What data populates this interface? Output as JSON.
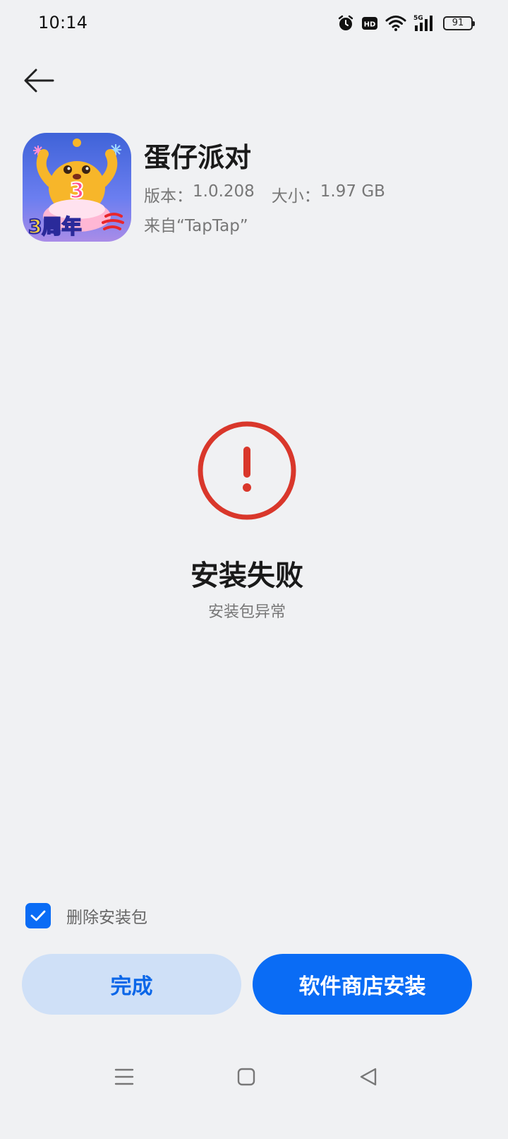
{
  "status_bar": {
    "time": "10:14",
    "battery": "91",
    "network": "5G",
    "hd_badge": "HD"
  },
  "app": {
    "name": "蛋仔派对",
    "version_label": "版本：",
    "version": "1.0.208",
    "size_label": "大小：",
    "size": "1.97 GB",
    "source": "来自“TapTap”",
    "icon_badge_text": "3周年",
    "icon_number": "3"
  },
  "result": {
    "title": "安装失败",
    "subtitle": "安装包异常",
    "status_color": "#d9372b"
  },
  "options": {
    "delete_package_label": "删除安装包",
    "delete_package_checked": true
  },
  "actions": {
    "done_label": "完成",
    "store_install_label": "软件商店安装"
  },
  "colors": {
    "accent": "#0a6cf5",
    "background": "#f0f1f3",
    "error": "#d9372b"
  }
}
